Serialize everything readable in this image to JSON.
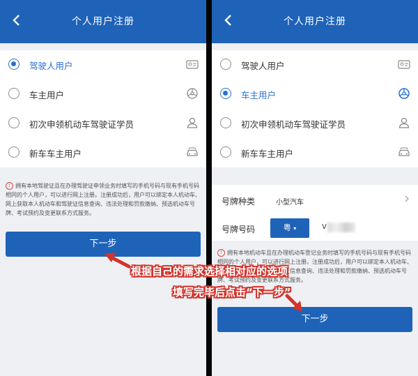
{
  "left_screen": {
    "header": {
      "title": "个人用户注册"
    },
    "options": [
      {
        "label": "驾驶人用户",
        "selected": true,
        "icon": "id-card-icon"
      },
      {
        "label": "车主用户",
        "selected": false,
        "icon": "steering-wheel-icon"
      },
      {
        "label": "初次申领机动车驾驶证学员",
        "selected": false,
        "icon": "person-icon"
      },
      {
        "label": "新车车主用户",
        "selected": false,
        "icon": "car-icon"
      }
    ],
    "notice": "拥有本地驾驶证且在办理驾驶证申领业务时填写的手机号码与现有手机号码相同的个人用户，可以进行网上注册。注册成功后，用户可以绑定本人机动车、网上获取本人机动车和驾驶证信息查询、违法处理和罚款缴纳、预选机动车号牌、考试预约及变更联系方式服务。",
    "next_button": "下一步"
  },
  "right_screen": {
    "header": {
      "title": "个人用户注册"
    },
    "options": [
      {
        "label": "驾驶人用户",
        "selected": false,
        "icon": "id-card-icon"
      },
      {
        "label": "车主用户",
        "selected": true,
        "icon": "steering-wheel-icon"
      },
      {
        "label": "初次申领机动车驾驶证学员",
        "selected": false,
        "icon": "person-icon"
      },
      {
        "label": "新车车主用户",
        "selected": false,
        "icon": "car-icon"
      }
    ],
    "plate_type_label": "号牌种类",
    "plate_type_value": "小型汽车",
    "plate_number_label": "号牌号码",
    "province_value": "粤",
    "plate_number_value": "V",
    "notice": "拥有本地机动车且在办理机动车登记业务时填写的手机号码与现有手机号码相同的个人用户，可以进行网上注册。注册成功后，用户可以绑定本人机动车、网上获取本人机动车和驾驶证信息查询、违法处理和罚款缴纳、预选机动车号牌、考试预约及变更联系方式服务。",
    "next_button": "下一步"
  },
  "annotations": {
    "line1": "根据自己的需求选择相对应的选项",
    "line2": "填写完毕后点击“下一步”",
    "color": "#d2342c"
  },
  "colors": {
    "header": "#1f63b8",
    "accent": "#2a6fd0",
    "background": "#eef0f4"
  }
}
